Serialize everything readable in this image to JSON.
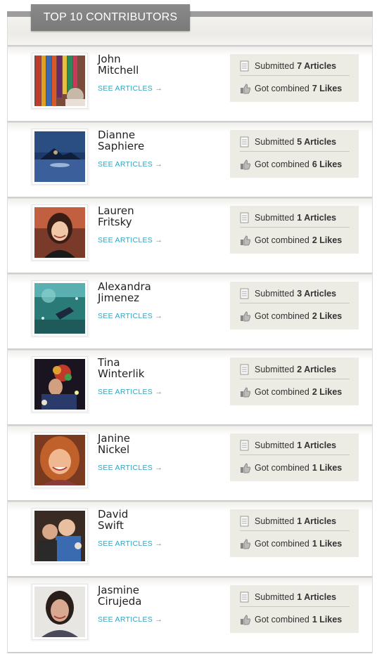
{
  "header": {
    "title": "TOP 10 CONTRIBUTORS"
  },
  "link_label": "SEE ARTICLES →",
  "contributors": [
    {
      "first": "John",
      "last": "Mitchell",
      "articles_prefix": "Submitted",
      "articles": "7 Articles",
      "likes_prefix": "Got combined",
      "likes": "7 Likes"
    },
    {
      "first": "Dianne",
      "last": "Saphiere",
      "articles_prefix": "Submitted",
      "articles": "5 Articles",
      "likes_prefix": "Got combined",
      "likes": "6 Likes"
    },
    {
      "first": "Lauren",
      "last": "Fritsky",
      "articles_prefix": "Submitted",
      "articles": "1 Articles",
      "likes_prefix": "Got combined",
      "likes": "2 Likes"
    },
    {
      "first": "Alexandra",
      "last": "Jimenez",
      "articles_prefix": "Submitted",
      "articles": "3 Articles",
      "likes_prefix": "Got combined",
      "likes": "2 Likes"
    },
    {
      "first": "Tina",
      "last": "Winterlik",
      "articles_prefix": "Submitted",
      "articles": "2 Articles",
      "likes_prefix": "Got combined",
      "likes": "2 Likes"
    },
    {
      "first": "Janine",
      "last": "Nickel",
      "articles_prefix": "Submitted",
      "articles": "1 Articles",
      "likes_prefix": "Got combined",
      "likes": "1 Likes"
    },
    {
      "first": "David",
      "last": "Swift",
      "articles_prefix": "Submitted",
      "articles": "1 Articles",
      "likes_prefix": "Got combined",
      "likes": "1 Likes"
    },
    {
      "first": "Jasmine",
      "last": "Cirujeda",
      "articles_prefix": "Submitted",
      "articles": "1 Articles",
      "likes_prefix": "Got combined",
      "likes": "1 Likes"
    }
  ],
  "colors": {
    "link": "#2aa6c4",
    "header_bg": "#808080",
    "stats_bg": "#ecebe4"
  },
  "icons": {
    "articles": "document-icon",
    "likes": "thumbs-up-icon"
  }
}
